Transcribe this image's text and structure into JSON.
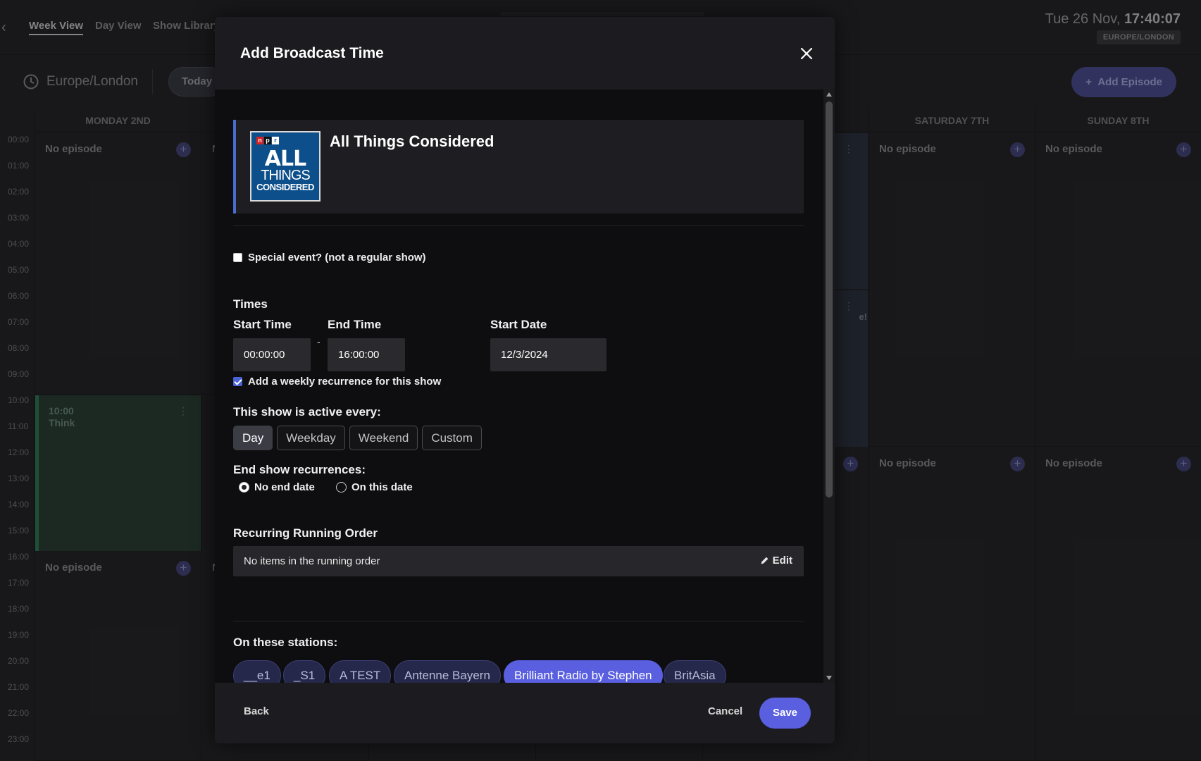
{
  "app": {
    "tabs": [
      {
        "label": "Week View",
        "active": true
      },
      {
        "label": "Day View",
        "active": false
      },
      {
        "label": "Show Library",
        "active": false
      }
    ],
    "clock": {
      "date": "Tue 26 Nov,",
      "time": "17:40:07",
      "timezone_badge": "EUROPE/LONDON"
    },
    "timezone": "Europe/London",
    "today_label": "Today",
    "add_episode_label": "Add Episode",
    "hours": [
      "00:00",
      "01:00",
      "02:00",
      "03:00",
      "04:00",
      "05:00",
      "06:00",
      "07:00",
      "08:00",
      "09:00",
      "10:00",
      "11:00",
      "12:00",
      "13:00",
      "14:00",
      "15:00",
      "16:00",
      "17:00",
      "18:00",
      "19:00",
      "20:00",
      "21:00",
      "22:00",
      "23:00"
    ],
    "days": {
      "monday": {
        "header": "MONDAY 2ND",
        "slot1": "No episode",
        "block_time": "10:00",
        "block_title": "Think",
        "slot2": "No episode"
      },
      "tuesday": {
        "slot1": "N",
        "slot2": "N"
      },
      "friday": {
        "partial": "e!"
      },
      "saturday": {
        "header": "SATURDAY 7TH",
        "slot1": "No episode",
        "slot2": "No episode"
      },
      "sunday": {
        "header": "SUNDAY 8TH",
        "slot1": "No episode",
        "slot2": "No episode"
      }
    }
  },
  "modal": {
    "title": "Add Broadcast Time",
    "show": {
      "name": "All Things Considered",
      "logo": {
        "brand": [
          "n",
          "p",
          "r"
        ],
        "line1": "ALL",
        "line2": "THINGS",
        "line3": "CONSIDERED",
        "bg_color": "#0d4f8a"
      }
    },
    "special_event": {
      "label": "Special event? (not a regular show)",
      "checked": false
    },
    "times": {
      "section_label": "Times",
      "start_time_label": "Start Time",
      "start_time_value": "00:00:00",
      "separator": "-",
      "end_time_label": "End Time",
      "end_time_value": "16:00:00",
      "start_date_label": "Start Date",
      "start_date_value": "12/3/2024"
    },
    "weekly_recurrence": {
      "label": "Add a weekly recurrence for this show",
      "checked": true
    },
    "active_every": {
      "label": "This show is active every:",
      "options": [
        "Day",
        "Weekday",
        "Weekend",
        "Custom"
      ],
      "selected": "Day"
    },
    "end_recurrences": {
      "label": "End show recurrences:",
      "options": [
        "No end date",
        "On this date"
      ],
      "selected": "No end date"
    },
    "running_order": {
      "label": "Recurring Running Order",
      "empty_text": "No items in the running order",
      "edit_label": "Edit"
    },
    "stations": {
      "label": "On these stations:",
      "items": [
        {
          "name": "__e1",
          "selected": false
        },
        {
          "name": "_S1",
          "selected": false
        },
        {
          "name": "A TEST",
          "selected": false
        },
        {
          "name": "Antenne Bayern",
          "selected": false
        },
        {
          "name": "Brilliant Radio by Stephen",
          "selected": true
        },
        {
          "name": "BritAsia",
          "selected": false
        }
      ]
    },
    "footer": {
      "back_label": "Back",
      "cancel_label": "Cancel",
      "save_label": "Save"
    }
  },
  "colors": {
    "accent": "#5a5fe0",
    "card_accent": "#4a6dcc",
    "show_block": "#2a3f35"
  },
  "icons": {
    "close": "close-icon",
    "clock": "clock-icon",
    "edit": "pencil-icon",
    "plus": "plus-icon"
  }
}
